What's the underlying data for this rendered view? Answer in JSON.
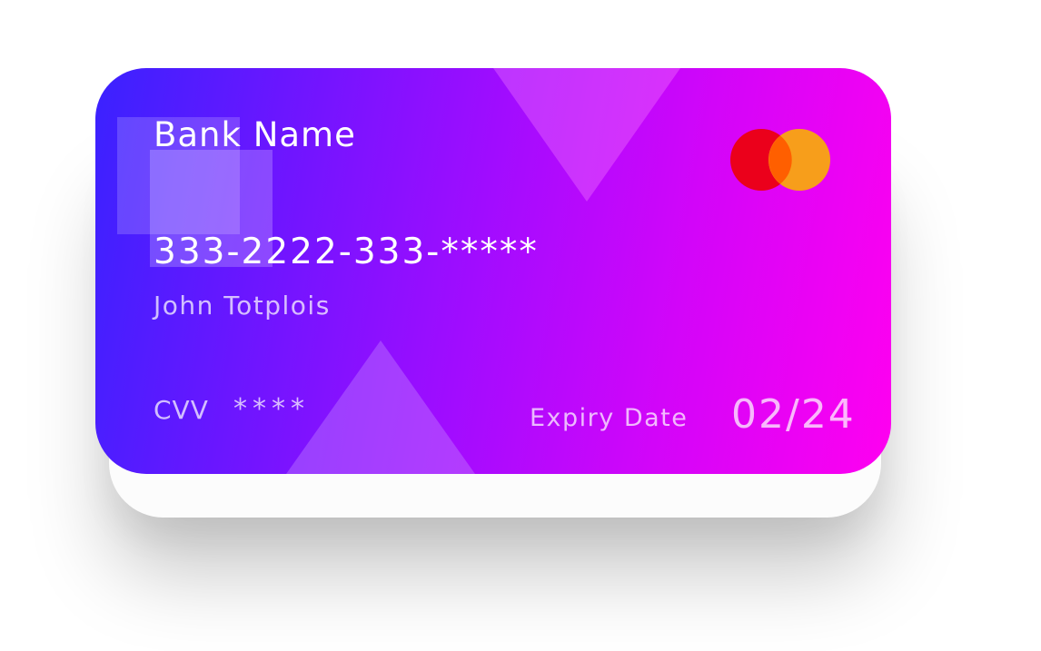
{
  "card": {
    "bank_name": "Bank Name",
    "number": "333-2222-333-*****",
    "holder_name": "John Totplois",
    "cvv_label": "CVV",
    "cvv_value": "****",
    "expiry_label": "Expiry Date",
    "expiry_value": "02/24",
    "logo": "mastercard-logo-icon"
  },
  "colors": {
    "gradient_start": "#3a22ff",
    "gradient_end": "#ff00f0",
    "logo_red": "#eb001b",
    "logo_orange": "#f79e1b",
    "logo_overlap": "#ff5f00"
  }
}
